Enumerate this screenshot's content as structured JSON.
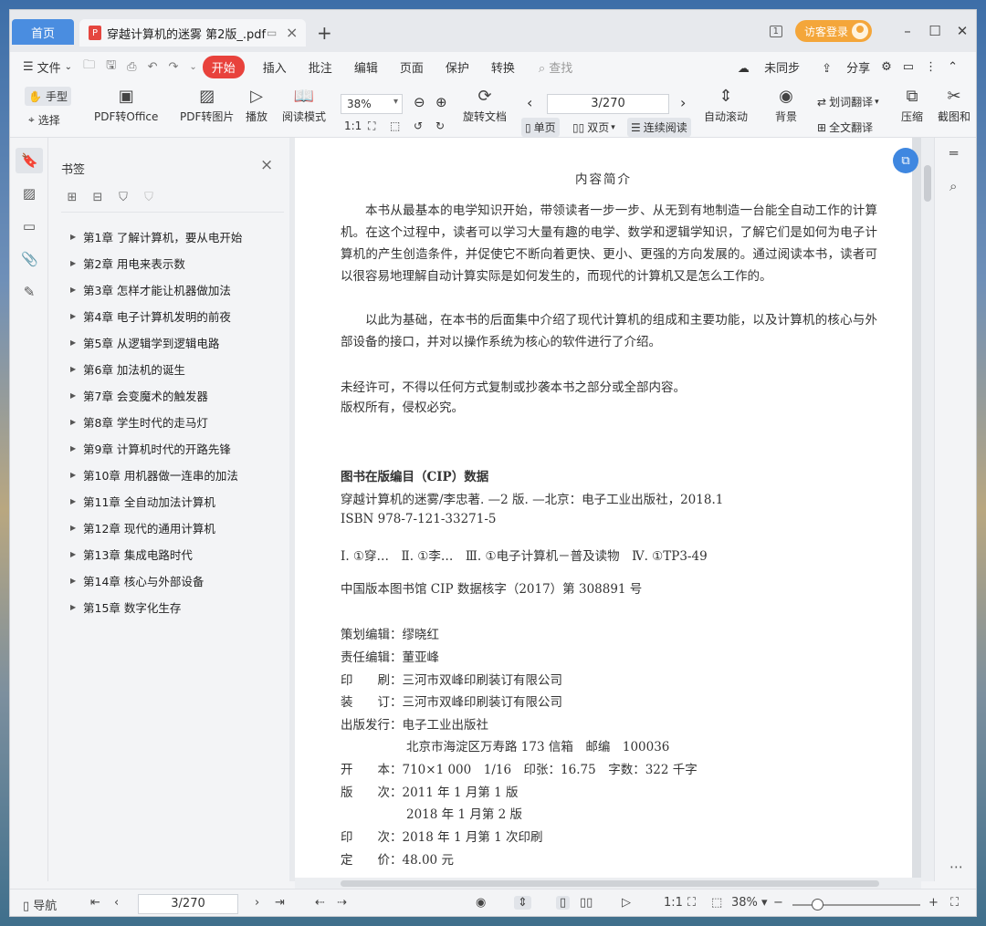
{
  "titlebar": {
    "home_tab": "首页",
    "doc_tab": "穿越计算机的迷雾 第2版_.pdf",
    "pdf_badge": "P",
    "new_tab": "+",
    "login": "访客登录",
    "page_count_badge": "1"
  },
  "menu": {
    "file": "文件",
    "start": "开始",
    "items": [
      "插入",
      "批注",
      "编辑",
      "页面",
      "保护",
      "转换"
    ],
    "search_placeholder": "查找",
    "sync": "未同步",
    "share": "分享"
  },
  "toolbar": {
    "hand": "手型",
    "select": "选择",
    "pdf_to_office": "PDF转Office",
    "pdf_to_image": "PDF转图片",
    "play": "播放",
    "read_mode": "阅读模式",
    "zoom": "38%",
    "rotate": "旋转文档",
    "page_indicator": "3/270",
    "single_page": "单页",
    "double_page": "双页",
    "continuous": "连续阅读",
    "auto_scroll": "自动滚动",
    "background": "背景",
    "word_translate": "划词翻译",
    "full_translate": "全文翻译",
    "compress": "压缩",
    "screenshot": "截图和"
  },
  "bookmarks": {
    "title": "书签",
    "items": [
      "第1章  了解计算机，要从电开始",
      "第2章  用电来表示数",
      "第3章  怎样才能让机器做加法",
      "第4章  电子计算机发明的前夜",
      "第5章  从逻辑学到逻辑电路",
      "第6章  加法机的诞生",
      "第7章  会变魔术的触发器",
      "第8章  学生时代的走马灯",
      "第9章  计算机时代的开路先锋",
      "第10章  用机器做一连串的加法",
      "第11章  全自动加法计算机",
      "第12章  现代的通用计算机",
      "第13章  集成电路时代",
      "第14章  核心与外部设备",
      "第15章  数字化生存"
    ]
  },
  "document": {
    "heading": "内容简介",
    "para1": "本书从最基本的电学知识开始，带领读者一步一步、从无到有地制造一台能全自动工作的计算机。在这个过程中，读者可以学习大量有趣的电学、数学和逻辑学知识，了解它们是如何为电子计算机的产生创造条件，并促使它不断向着更快、更小、更强的方向发展的。通过阅读本书，读者可以很容易地理解自动计算实际是如何发生的，而现代的计算机又是怎么工作的。",
    "para2": "以此为基础，在本书的后面集中介绍了现代计算机的组成和主要功能，以及计算机的核心与外部设备的接口，并对以操作系统为核心的软件进行了介绍。",
    "copyright1": "未经许可，不得以任何方式复制或抄袭本书之部分或全部内容。",
    "copyright2": "版权所有，侵权必究。",
    "cip_title": "图书在版编目（CIP）数据",
    "cip_line1": "穿越计算机的迷雾/李忠著. —2 版. —北京：电子工业出版社，2018.1",
    "cip_isbn": "ISBN 978-7-121-33271-5",
    "cip_class": "Ⅰ. ①穿…　Ⅱ. ①李…　Ⅲ. ①电子计算机－普及读物　Ⅳ. ①TP3-49",
    "cip_record": "中国版本图书馆 CIP 数据核字（2017）第 308891 号",
    "planner": "策划编辑：缪晓红",
    "editor": "责任编辑：董亚峰",
    "printer": "印　　刷：三河市双峰印刷装订有限公司",
    "binder": "装　　订：三河市双峰印刷装订有限公司",
    "publisher": "出版发行：电子工业出版社",
    "address": "北京市海淀区万寿路 173 信箱　邮编　100036",
    "format": "开　　本：710×1 000　1/16　印张：16.75　字数：322 千字",
    "edition1": "版　　次：2011 年 1 月第 1 版",
    "edition2": "2018 年 1 月第 2 版",
    "printing": "印　　次：2018 年 1 月第 1 次印刷",
    "price": "定　　价：48.00 元"
  },
  "statusbar": {
    "nav": "导航",
    "page": "3/270",
    "zoom": "38%"
  }
}
